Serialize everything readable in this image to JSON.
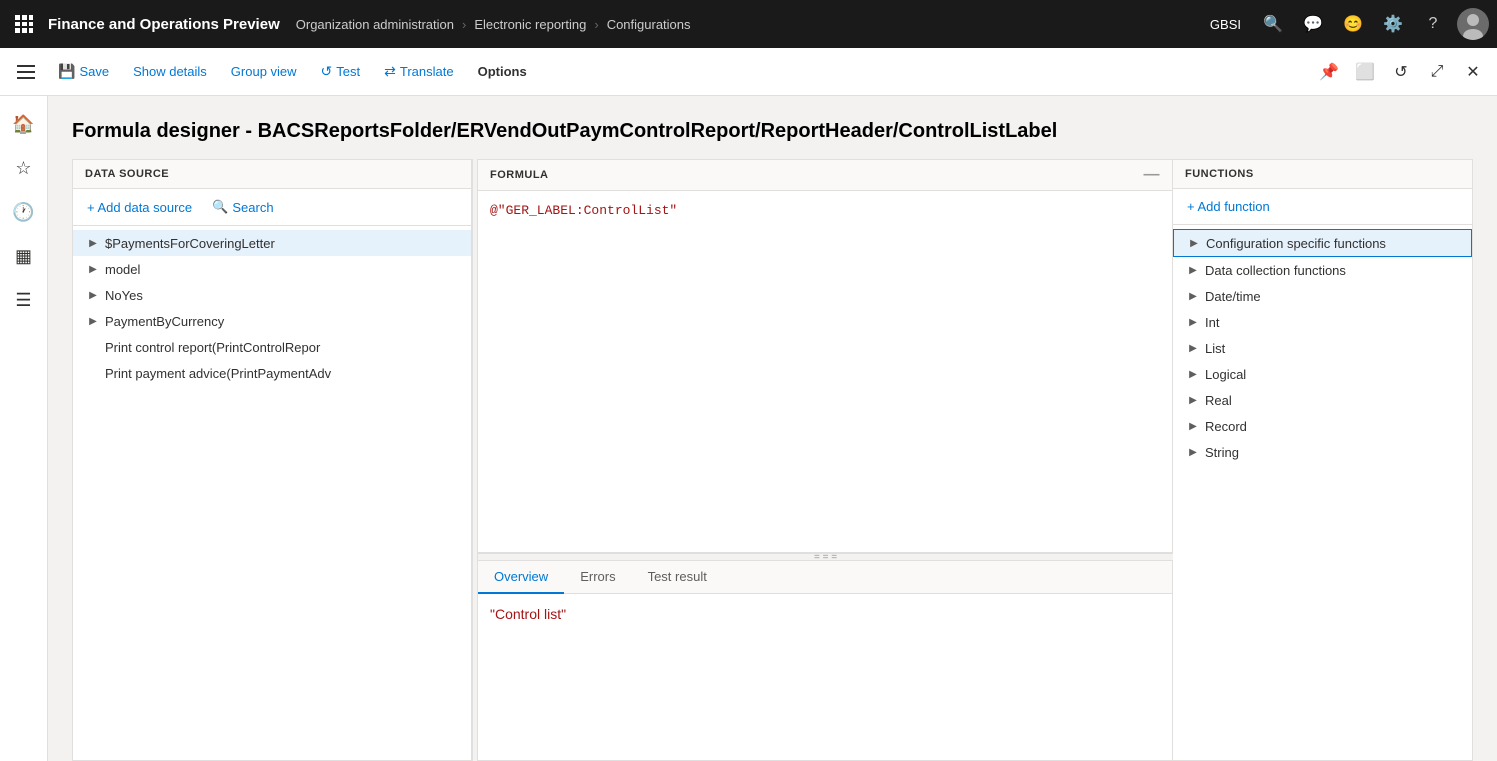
{
  "app": {
    "title": "Finance and Operations Preview"
  },
  "breadcrumb": {
    "items": [
      "Organization administration",
      "Electronic reporting",
      "Configurations"
    ]
  },
  "topnav": {
    "org": "GBSI",
    "icons": [
      "search",
      "chat",
      "emoji",
      "settings",
      "help"
    ]
  },
  "toolbar": {
    "save": "Save",
    "show_details": "Show details",
    "group_view": "Group view",
    "test": "Test",
    "translate": "Translate",
    "options": "Options"
  },
  "page": {
    "title": "Formula designer - BACSReportsFolder/ERVendOutPaymControlReport/ReportHeader/ControlListLabel"
  },
  "datasource": {
    "header": "DATA SOURCE",
    "add_btn": "+ Add data source",
    "search_btn": "Search",
    "items": [
      {
        "label": "$PaymentsForCoveringLetter",
        "expandable": true,
        "selected": true
      },
      {
        "label": "model",
        "expandable": true,
        "selected": false
      },
      {
        "label": "NoYes",
        "expandable": true,
        "selected": false
      },
      {
        "label": "PaymentByCurrency",
        "expandable": true,
        "selected": false
      },
      {
        "label": "Print control report(PrintControlRepor",
        "expandable": false,
        "selected": false
      },
      {
        "label": "Print payment advice(PrintPaymentAdv",
        "expandable": false,
        "selected": false
      }
    ]
  },
  "formula": {
    "header": "FORMULA",
    "value": "@\"GER_LABEL:ControlList\""
  },
  "tabs": {
    "items": [
      "Overview",
      "Errors",
      "Test result"
    ],
    "active": "Overview"
  },
  "overview": {
    "value": "\"Control list\""
  },
  "functions": {
    "header": "FUNCTIONS",
    "add_btn": "+ Add function",
    "items": [
      {
        "label": "Configuration specific functions",
        "expandable": true,
        "selected": true
      },
      {
        "label": "Data collection functions",
        "expandable": true,
        "selected": false
      },
      {
        "label": "Date/time",
        "expandable": true,
        "selected": false
      },
      {
        "label": "Int",
        "expandable": true,
        "selected": false
      },
      {
        "label": "List",
        "expandable": true,
        "selected": false
      },
      {
        "label": "Logical",
        "expandable": true,
        "selected": false
      },
      {
        "label": "Real",
        "expandable": true,
        "selected": false
      },
      {
        "label": "Record",
        "expandable": true,
        "selected": false
      },
      {
        "label": "String",
        "expandable": true,
        "selected": false
      }
    ]
  }
}
